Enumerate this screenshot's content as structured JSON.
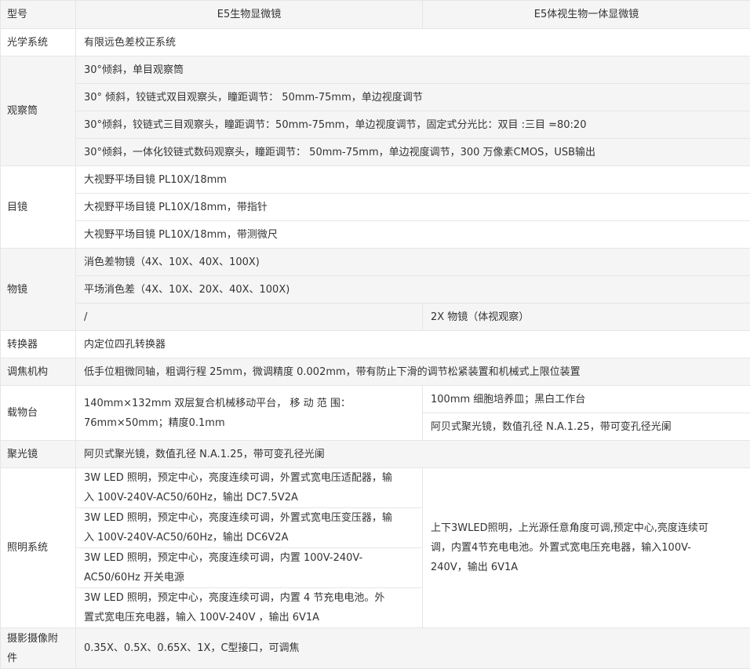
{
  "header": {
    "label": "型号",
    "col_e5": "E5生物显微镜",
    "col_e5_integrated": "E5体视生物一体显微镜"
  },
  "optical_system": {
    "label": "光学系统",
    "value": "有限远色差校正系统"
  },
  "observation_tube": {
    "label": "观察筒",
    "items": [
      "30°倾斜，单目观察筒",
      "30° 倾斜，铰链式双目观察头，瞳距调节： 50mm-75mm，单边视度调节",
      "30°倾斜，铰链式三目观察头，瞳距调节：50mm-75mm，单边视度调节，固定式分光比：双目 :三目 =80:20",
      "30°倾斜，一体化铰链式数码观察头，瞳距调节： 50mm-75mm，单边视度调节，300 万像素CMOS，USB输出"
    ]
  },
  "eyepiece": {
    "label": "目镜",
    "items": [
      "大视野平场目镜 PL10X/18mm",
      "大视野平场目镜 PL10X/18mm，带指针",
      "大视野平场目镜 PL10X/18mm，带测微尺"
    ]
  },
  "objective": {
    "label": "物镜",
    "items": [
      "消色差物镜（4X、10X、40X、100X)",
      "平场消色差（4X、10X、20X、40X、100X)"
    ],
    "e5_extra": "/",
    "integrated_extra": "2X 物镜（体视观察）"
  },
  "nosepiece": {
    "label": "转换器",
    "value": "内定位四孔转换器"
  },
  "focusing": {
    "label": "调焦机构",
    "value": "低手位粗微同轴，粗调行程 25mm，微调精度 0.002mm，带有防止下滑的调节松紧装置和机械式上限位装置"
  },
  "stage": {
    "label": "载物台",
    "e5_line1": "140mm×132mm 双层复合机械移动平台， 移 动 范 围：",
    "e5_line2": "76mm×50mm；精度0.1mm",
    "integrated_items": [
      "100mm 细胞培养皿；黑白工作台",
      "阿贝式聚光镜，数值孔径 N.A.1.25，带可变孔径光阑"
    ]
  },
  "condenser": {
    "label": "聚光镜",
    "value": "阿贝式聚光镜，数值孔径 N.A.1.25，带可变孔径光阑"
  },
  "illumination": {
    "label": "照明系统",
    "e5_items": [
      {
        "line1": "3W LED 照明，预定中心，亮度连续可调，外置式宽电压适配器，输",
        "line2": "入 100V-240V-AC50/60Hz，输出 DC7.5V2A"
      },
      {
        "line1": "3W LED 照明，预定中心，亮度连续可调，外置式宽电压变压器，输",
        "line2": "入 100V-240V-AC50/60Hz，输出 DC6V2A"
      },
      {
        "line1": "3W LED 照明，预定中心，亮度连续可调，内置 100V-240V-",
        "line2": "AC50/60Hz 开关电源"
      },
      {
        "line1": "3W LED 照明，预定中心，亮度连续可调，内置 4 节充电电池。外",
        "line2": "置式宽电压充电器，输入 100V-240V ，输出 6V1A"
      }
    ],
    "integrated_line1": "上下3WLED照明，上光源任意角度可调,预定中心,亮度连续可",
    "integrated_line2": "调，内置4节充电电池。外置式宽电压充电器，输入100V-",
    "integrated_line3": "240V，输出 6V1A"
  },
  "camera_adapter": {
    "label_line1": "摄影摄像附",
    "label_line2": "件",
    "value": "0.35X、0.5X、0.65X、1X，C型接口，可调焦"
  }
}
